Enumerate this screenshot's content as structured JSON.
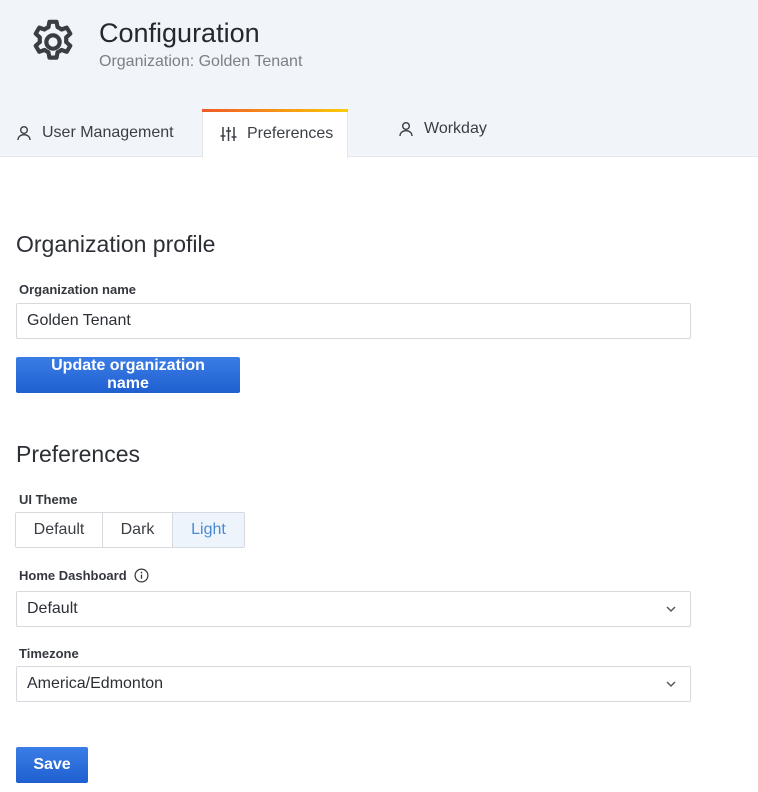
{
  "header": {
    "icon": "gear-icon",
    "title": "Configuration",
    "subtitle": "Organization: Golden Tenant"
  },
  "tabs": [
    {
      "label": "User Management",
      "icon": "user-icon",
      "active": false
    },
    {
      "label": "Preferences",
      "icon": "sliders-icon",
      "active": true
    },
    {
      "label": "Workday",
      "icon": "user-icon",
      "active": false
    }
  ],
  "org_profile": {
    "title": "Organization profile",
    "name_label": "Organization name",
    "name_value": "Golden Tenant",
    "update_button": "Update organization name"
  },
  "preferences": {
    "title": "Preferences",
    "theme_label": "UI Theme",
    "theme_options": [
      "Default",
      "Dark",
      "Light"
    ],
    "theme_selected": "Light",
    "home_dashboard_label": "Home Dashboard",
    "home_dashboard_value": "Default",
    "timezone_label": "Timezone",
    "timezone_value": "America/Edmonton",
    "save_button": "Save"
  },
  "colors": {
    "primary_button": "#1f5fd0",
    "header_bg": "#f1f4f8",
    "tab_accent_start": "#f05a28",
    "tab_accent_end": "#fbca0a",
    "selected_option_text": "#4a8ad0"
  }
}
